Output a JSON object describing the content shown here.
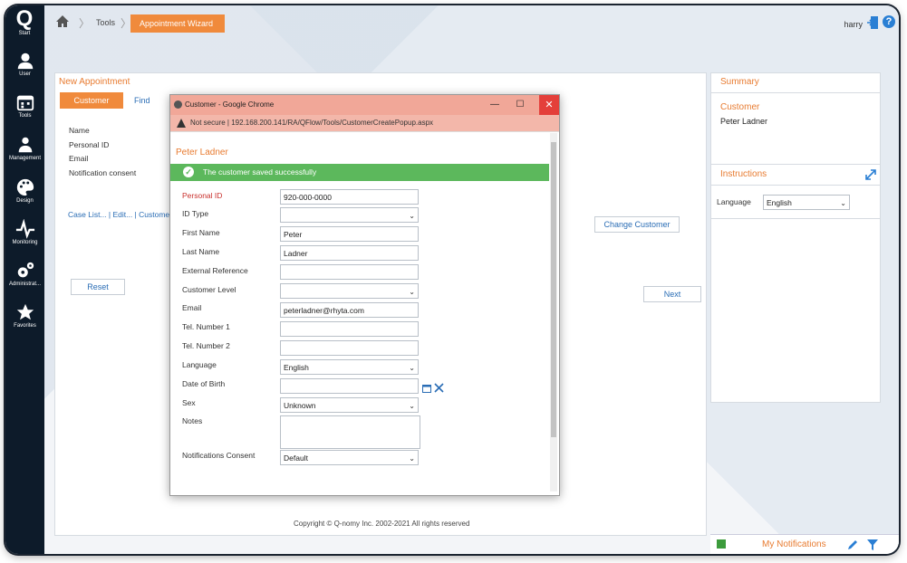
{
  "sidebar": {
    "logo": "Q",
    "items": [
      {
        "label": "Start",
        "icon": "q-logo-icon"
      },
      {
        "label": "User",
        "icon": "user-icon"
      },
      {
        "label": "Tools",
        "icon": "calendar-icon"
      },
      {
        "label": "Management",
        "icon": "people-icon"
      },
      {
        "label": "Design",
        "icon": "palette-icon"
      },
      {
        "label": "Monitoring",
        "icon": "pulse-icon"
      },
      {
        "label": "Administrat...",
        "icon": "gears-icon"
      },
      {
        "label": "Favorites",
        "icon": "star-icon"
      }
    ]
  },
  "header": {
    "breadcrumbs": [
      "Tools",
      "Appointment Wizard"
    ],
    "user": "harry"
  },
  "appointment": {
    "title": "New Appointment",
    "steps": [
      "Customer",
      "Find"
    ],
    "fields": [
      "Name",
      "Personal ID",
      "Email",
      "Notification consent"
    ],
    "links": "Case List... | Edit... | Customer",
    "change_customer": "Change Customer",
    "reset": "Reset",
    "next": "Next"
  },
  "summary": {
    "title": "Summary",
    "customer_heading": "Customer",
    "customer_name": "Peter Ladner"
  },
  "instructions": {
    "title": "Instructions",
    "language_label": "Language",
    "language_value": "English"
  },
  "popup": {
    "window_title": "Customer - Google Chrome",
    "not_secure": "Not secure",
    "url": "192.168.200.141/RA/QFlow/Tools/CustomerCreatePopup.aspx",
    "customer_name": "Peter Ladner",
    "success_message": "The customer saved successfully",
    "form": {
      "personal_id": {
        "label": "Personal ID",
        "value": "920-000-0000"
      },
      "id_type": {
        "label": "ID Type",
        "value": ""
      },
      "first_name": {
        "label": "First Name",
        "value": "Peter"
      },
      "last_name": {
        "label": "Last Name",
        "value": "Ladner"
      },
      "external_reference": {
        "label": "External Reference",
        "value": ""
      },
      "customer_level": {
        "label": "Customer Level",
        "value": ""
      },
      "email": {
        "label": "Email",
        "value": "peterladner@rhyta.com"
      },
      "tel1": {
        "label": "Tel. Number 1",
        "value": ""
      },
      "tel2": {
        "label": "Tel. Number 2",
        "value": ""
      },
      "language": {
        "label": "Language",
        "value": "English"
      },
      "dob": {
        "label": "Date of Birth",
        "value": ""
      },
      "sex": {
        "label": "Sex",
        "value": "Unknown"
      },
      "notes": {
        "label": "Notes",
        "value": ""
      },
      "notifications_consent": {
        "label": "Notifications Consent",
        "value": "Default"
      }
    }
  },
  "footer": {
    "copyright": "Copyright © Q-nomy Inc. 2002-2021 All rights reserved",
    "notifications": "My Notifications"
  },
  "colors": {
    "accent": "#f08a3c",
    "sidebar": "#0d1b2a",
    "success": "#5cb85c",
    "popup_titlebar": "#f1a798"
  }
}
